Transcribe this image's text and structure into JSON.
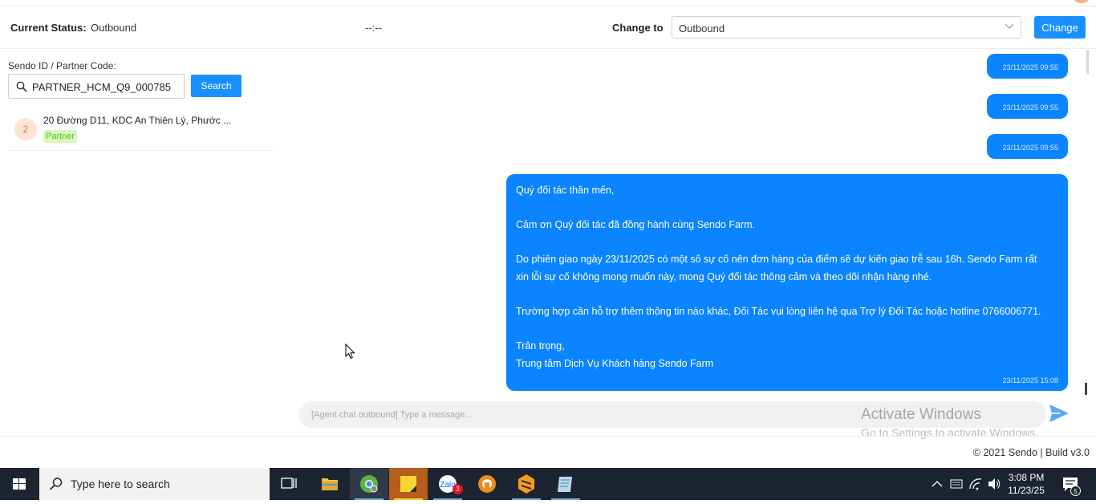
{
  "status_bar": {
    "current_status_label": "Current Status:",
    "current_status_value": "Outbound",
    "timer": "--:--",
    "change_to_label": "Change to",
    "change_to_value": "Outbound",
    "change_button": "Change"
  },
  "search": {
    "label": "Sendo ID / Partner Code:",
    "value": "PARTNER_HCM_Q9_000785",
    "button": "Search"
  },
  "results": [
    {
      "number": "2",
      "address": "20 Đường D11, KDC An Thiên Lý, Phước ...",
      "tag": "Partner"
    }
  ],
  "messages": {
    "small": [
      {
        "timestamp": "23/11/2025 09:55"
      },
      {
        "timestamp": "23/11/2025 09:55"
      },
      {
        "timestamp": "23/11/2025 09:55"
      }
    ],
    "main": {
      "line1": "Quý đối tác thân mến,",
      "line2": "Cảm ơn Quý đối tác đã đồng hành cùng Sendo Farm.",
      "line3": "Do phiên giao ngày 23/11/2025 có một số sự cố nên đơn hàng của điểm sẽ dự kiến giao trễ sau 16h. Sendo Farm rất",
      "line4": "xin lỗi sự cố không mong muốn này, mong  Quý đối tác thông cảm và theo dõi nhận hàng nhé.",
      "line5": "Trường hợp cần hỗ trợ thêm thông tin nào khác, Đối Tác vui lòng liên hệ qua Trợ lý Đối Tác hoặc hotline 0766006771.",
      "line6": "Trân trọng,",
      "line7": "Trung tâm Dịch Vụ Khách hàng Sendo Farm",
      "timestamp": "23/11/2025 15:08"
    }
  },
  "composer": {
    "placeholder": "[Agent chat outbound] Type a message..."
  },
  "watermark": {
    "title": "Activate Windows",
    "subtitle": "Go to Settings to activate Windows."
  },
  "footer": "© 2021 Sendo | Build v3.0",
  "taskbar": {
    "search_placeholder": "Type here to search",
    "zalo_badge": "3",
    "notification_badge": "5",
    "time": "3:08 PM",
    "date": "11/23/25"
  },
  "colors": {
    "accent": "#1890ff",
    "bubble": "#0a84ff",
    "taskbar": "#1b2430"
  }
}
